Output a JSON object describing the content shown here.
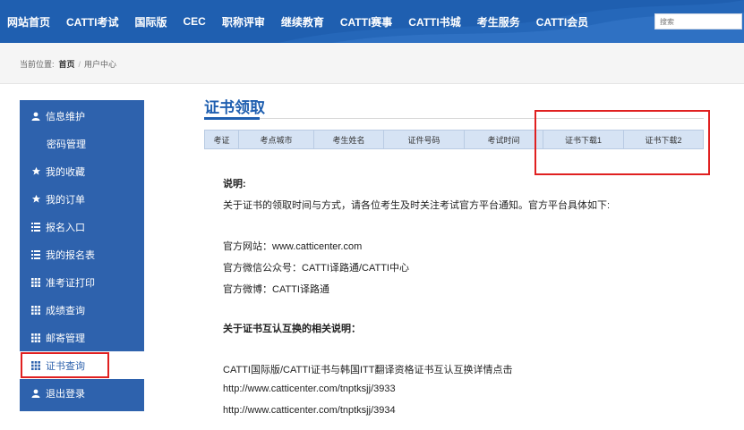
{
  "nav": {
    "items": [
      "网站首页",
      "CATTI考试",
      "国际版",
      "CEC",
      "职称评审",
      "继续教育",
      "CATTI赛事",
      "CATTI书城",
      "考生服务",
      "CATTI会员"
    ],
    "search_placeholder": "搜索"
  },
  "breadcrumb": {
    "label": "当前位置:",
    "home": "首页",
    "separator": "/",
    "current": "用户中心"
  },
  "sidebar": {
    "items": [
      {
        "label": "信息维护",
        "icon": "user-icon"
      },
      {
        "label": "密码管理",
        "icon": ""
      },
      {
        "label": "我的收藏",
        "icon": "star-icon"
      },
      {
        "label": "我的订单",
        "icon": "star-icon"
      },
      {
        "label": "报名入口",
        "icon": "list-icon"
      },
      {
        "label": "我的报名表",
        "icon": "list-icon"
      },
      {
        "label": "准考证打印",
        "icon": "grid-icon"
      },
      {
        "label": "成绩查询",
        "icon": "grid-icon"
      },
      {
        "label": "邮寄管理",
        "icon": "grid-icon"
      },
      {
        "label": "证书查询",
        "icon": "grid-icon"
      },
      {
        "label": "退出登录",
        "icon": "user-icon"
      }
    ]
  },
  "main": {
    "title": "证书领取",
    "table_headers": [
      "考证",
      "考点城市",
      "考生姓名",
      "证件号码",
      "考试时间",
      "证书下载1",
      "证书下载2"
    ],
    "content": {
      "note_title": "说明:",
      "note_text": "关于证书的领取时间与方式，请各位考生及时关注考试官方平台通知。官方平台具体如下:",
      "site": "官方网站：www.catticenter.com",
      "wechat": "官方微信公众号：CATTI译路通/CATTI中心",
      "weibo": "官方微博：CATTI译路通",
      "mutual_title": "关于证书互认互换的相关说明：",
      "mutual_text": "CATTI国际版/CATTI证书与韩国ITT翻译资格证书互认互换详情点击",
      "link1": "http://www.catticenter.com/tnptksjj/3933",
      "link2": "http://www.catticenter.com/tnptksjj/3934"
    }
  },
  "colors": {
    "nav_bg": "#1f5fb0",
    "sidebar_bg": "#2e62ad",
    "table_header_bg": "#d6e3f4",
    "highlight": "#e02020"
  }
}
